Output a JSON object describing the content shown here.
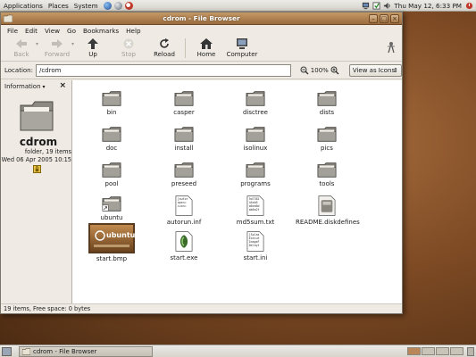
{
  "top_panel": {
    "menus": [
      "Applications",
      "Places",
      "System"
    ],
    "clock": "Thu May 12,  6:33 PM"
  },
  "window": {
    "title": "cdrom - File Browser",
    "menubar": [
      "File",
      "Edit",
      "View",
      "Go",
      "Bookmarks",
      "Help"
    ],
    "toolbar": {
      "back": "Back",
      "forward": "Forward",
      "up": "Up",
      "stop": "Stop",
      "reload": "Reload",
      "home": "Home",
      "computer": "Computer"
    },
    "location": {
      "label": "Location:",
      "value": "/cdrom",
      "zoom": "100%",
      "view_mode": "View as Icons"
    },
    "sidepane": {
      "selector": "Information",
      "folder_name": "cdrom",
      "meta_line1": "folder, 19 items",
      "meta_line2": "Wed 06 Apr 2005 10:15"
    },
    "files": [
      {
        "name": "bin",
        "kind": "folder"
      },
      {
        "name": "casper",
        "kind": "folder"
      },
      {
        "name": "disctree",
        "kind": "folder"
      },
      {
        "name": "dists",
        "kind": "folder"
      },
      {
        "name": "doc",
        "kind": "folder"
      },
      {
        "name": "install",
        "kind": "folder"
      },
      {
        "name": "isolinux",
        "kind": "folder"
      },
      {
        "name": "pics",
        "kind": "folder"
      },
      {
        "name": "pool",
        "kind": "folder"
      },
      {
        "name": "preseed",
        "kind": "folder"
      },
      {
        "name": "programs",
        "kind": "folder"
      },
      {
        "name": "tools",
        "kind": "folder"
      },
      {
        "name": "ubuntu",
        "kind": "folder-link"
      },
      {
        "name": "autorun.inf",
        "kind": "text",
        "preview": [
          "[autor",
          "open=",
          "icon="
        ]
      },
      {
        "name": "md5sum.txt",
        "kind": "text",
        "preview": [
          "5d7381",
          "44eb5",
          "a6ea6d",
          "ab6a2f"
        ]
      },
      {
        "name": "README.diskdefines",
        "kind": "generic"
      },
      {
        "name": "start.bmp",
        "kind": "image",
        "preview": [
          "ubuntu"
        ]
      },
      {
        "name": "start.exe",
        "kind": "exe"
      },
      {
        "name": "start.ini",
        "kind": "text",
        "preview": [
          "[Splas",
          "Execut",
          "ImageF",
          "Delayt"
        ]
      }
    ],
    "status": "19 items, Free space: 0 bytes"
  },
  "bottom_panel": {
    "task": "cdrom - File Browser"
  },
  "colors": {
    "titlebar": "#b0804f",
    "desktop": "#7d4a24",
    "folder": "#9a978f"
  }
}
